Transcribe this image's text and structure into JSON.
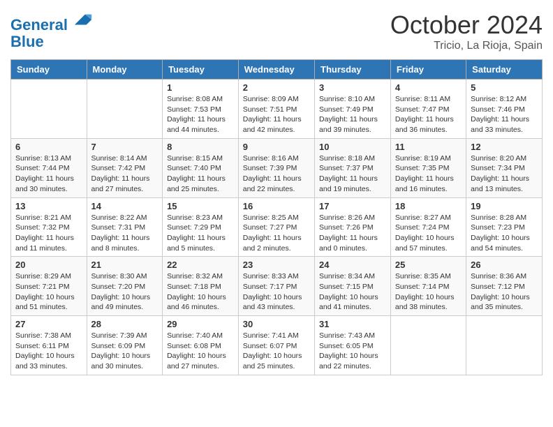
{
  "header": {
    "logo_line1": "General",
    "logo_line2": "Blue",
    "month": "October 2024",
    "location": "Tricio, La Rioja, Spain"
  },
  "weekdays": [
    "Sunday",
    "Monday",
    "Tuesday",
    "Wednesday",
    "Thursday",
    "Friday",
    "Saturday"
  ],
  "weeks": [
    [
      {
        "day": "",
        "info": ""
      },
      {
        "day": "",
        "info": ""
      },
      {
        "day": "1",
        "info": "Sunrise: 8:08 AM\nSunset: 7:53 PM\nDaylight: 11 hours and 44 minutes."
      },
      {
        "day": "2",
        "info": "Sunrise: 8:09 AM\nSunset: 7:51 PM\nDaylight: 11 hours and 42 minutes."
      },
      {
        "day": "3",
        "info": "Sunrise: 8:10 AM\nSunset: 7:49 PM\nDaylight: 11 hours and 39 minutes."
      },
      {
        "day": "4",
        "info": "Sunrise: 8:11 AM\nSunset: 7:47 PM\nDaylight: 11 hours and 36 minutes."
      },
      {
        "day": "5",
        "info": "Sunrise: 8:12 AM\nSunset: 7:46 PM\nDaylight: 11 hours and 33 minutes."
      }
    ],
    [
      {
        "day": "6",
        "info": "Sunrise: 8:13 AM\nSunset: 7:44 PM\nDaylight: 11 hours and 30 minutes."
      },
      {
        "day": "7",
        "info": "Sunrise: 8:14 AM\nSunset: 7:42 PM\nDaylight: 11 hours and 27 minutes."
      },
      {
        "day": "8",
        "info": "Sunrise: 8:15 AM\nSunset: 7:40 PM\nDaylight: 11 hours and 25 minutes."
      },
      {
        "day": "9",
        "info": "Sunrise: 8:16 AM\nSunset: 7:39 PM\nDaylight: 11 hours and 22 minutes."
      },
      {
        "day": "10",
        "info": "Sunrise: 8:18 AM\nSunset: 7:37 PM\nDaylight: 11 hours and 19 minutes."
      },
      {
        "day": "11",
        "info": "Sunrise: 8:19 AM\nSunset: 7:35 PM\nDaylight: 11 hours and 16 minutes."
      },
      {
        "day": "12",
        "info": "Sunrise: 8:20 AM\nSunset: 7:34 PM\nDaylight: 11 hours and 13 minutes."
      }
    ],
    [
      {
        "day": "13",
        "info": "Sunrise: 8:21 AM\nSunset: 7:32 PM\nDaylight: 11 hours and 11 minutes."
      },
      {
        "day": "14",
        "info": "Sunrise: 8:22 AM\nSunset: 7:31 PM\nDaylight: 11 hours and 8 minutes."
      },
      {
        "day": "15",
        "info": "Sunrise: 8:23 AM\nSunset: 7:29 PM\nDaylight: 11 hours and 5 minutes."
      },
      {
        "day": "16",
        "info": "Sunrise: 8:25 AM\nSunset: 7:27 PM\nDaylight: 11 hours and 2 minutes."
      },
      {
        "day": "17",
        "info": "Sunrise: 8:26 AM\nSunset: 7:26 PM\nDaylight: 11 hours and 0 minutes."
      },
      {
        "day": "18",
        "info": "Sunrise: 8:27 AM\nSunset: 7:24 PM\nDaylight: 10 hours and 57 minutes."
      },
      {
        "day": "19",
        "info": "Sunrise: 8:28 AM\nSunset: 7:23 PM\nDaylight: 10 hours and 54 minutes."
      }
    ],
    [
      {
        "day": "20",
        "info": "Sunrise: 8:29 AM\nSunset: 7:21 PM\nDaylight: 10 hours and 51 minutes."
      },
      {
        "day": "21",
        "info": "Sunrise: 8:30 AM\nSunset: 7:20 PM\nDaylight: 10 hours and 49 minutes."
      },
      {
        "day": "22",
        "info": "Sunrise: 8:32 AM\nSunset: 7:18 PM\nDaylight: 10 hours and 46 minutes."
      },
      {
        "day": "23",
        "info": "Sunrise: 8:33 AM\nSunset: 7:17 PM\nDaylight: 10 hours and 43 minutes."
      },
      {
        "day": "24",
        "info": "Sunrise: 8:34 AM\nSunset: 7:15 PM\nDaylight: 10 hours and 41 minutes."
      },
      {
        "day": "25",
        "info": "Sunrise: 8:35 AM\nSunset: 7:14 PM\nDaylight: 10 hours and 38 minutes."
      },
      {
        "day": "26",
        "info": "Sunrise: 8:36 AM\nSunset: 7:12 PM\nDaylight: 10 hours and 35 minutes."
      }
    ],
    [
      {
        "day": "27",
        "info": "Sunrise: 7:38 AM\nSunset: 6:11 PM\nDaylight: 10 hours and 33 minutes."
      },
      {
        "day": "28",
        "info": "Sunrise: 7:39 AM\nSunset: 6:09 PM\nDaylight: 10 hours and 30 minutes."
      },
      {
        "day": "29",
        "info": "Sunrise: 7:40 AM\nSunset: 6:08 PM\nDaylight: 10 hours and 27 minutes."
      },
      {
        "day": "30",
        "info": "Sunrise: 7:41 AM\nSunset: 6:07 PM\nDaylight: 10 hours and 25 minutes."
      },
      {
        "day": "31",
        "info": "Sunrise: 7:43 AM\nSunset: 6:05 PM\nDaylight: 10 hours and 22 minutes."
      },
      {
        "day": "",
        "info": ""
      },
      {
        "day": "",
        "info": ""
      }
    ]
  ]
}
